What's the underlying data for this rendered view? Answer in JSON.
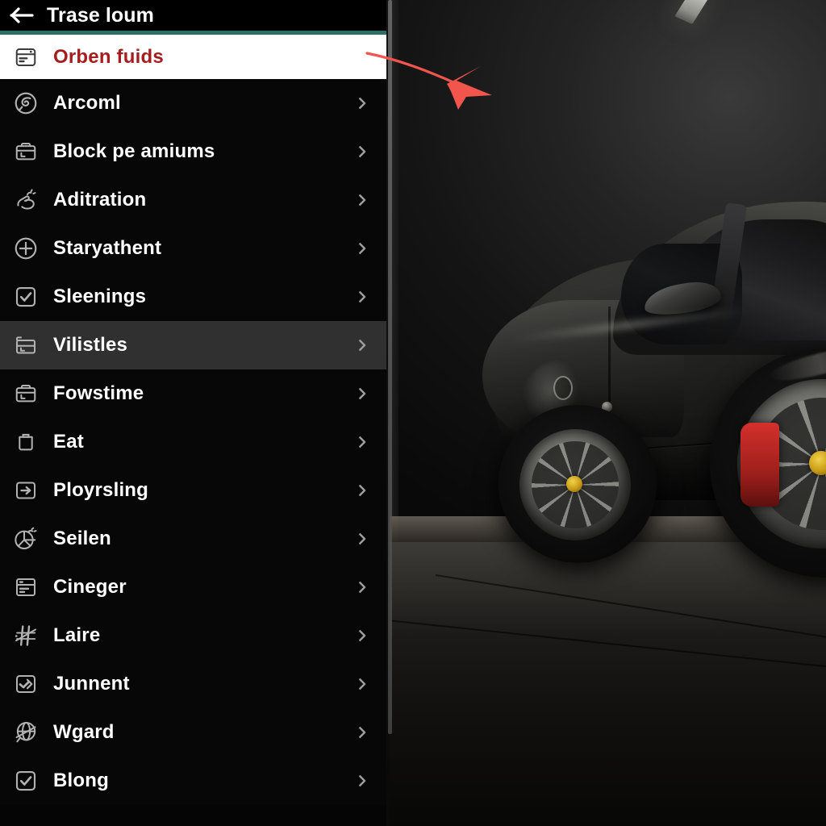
{
  "header": {
    "title": "Trase loum",
    "back_icon": "back-arrow-icon"
  },
  "colors": {
    "panel_background": "#070707",
    "selected_row_background": "#ffffff",
    "selected_row_text": "#a61d1d",
    "selected_row_accent": "#2e6e63",
    "hovered_row_background": "#303030",
    "row_text": "#ffffff",
    "icon": "#b2b2b2",
    "chevron": "#9c9c9c",
    "annotation_arrow": "#f2554c"
  },
  "annotation": {
    "type": "arrow",
    "name": "red-callout-arrow",
    "points_to": "Orben fuids",
    "color": "#f2554c"
  },
  "scrollbar": {
    "visible": true,
    "orientation": "vertical"
  },
  "menu": {
    "items": [
      {
        "label": "Orben fuids",
        "icon": "card-icon",
        "chevron": "",
        "state": "selected"
      },
      {
        "label": "Arcoml",
        "icon": "disc-icon",
        "chevron": "›",
        "state": "normal"
      },
      {
        "label": "Block pe amiums",
        "icon": "toolbox-icon",
        "chevron": "›",
        "state": "normal"
      },
      {
        "label": "Aditration",
        "icon": "hand-tap-icon",
        "chevron": "›",
        "state": "normal"
      },
      {
        "label": "Staryathent",
        "icon": "plus-circle-icon",
        "chevron": "›",
        "state": "normal"
      },
      {
        "label": "Sleenings",
        "icon": "checkbox-icon",
        "chevron": "›",
        "state": "normal"
      },
      {
        "label": "Vilistles",
        "icon": "drawer-icon",
        "chevron": "›",
        "state": "hovered"
      },
      {
        "label": "Fowstime",
        "icon": "toolbox-icon",
        "chevron": "›",
        "state": "normal"
      },
      {
        "label": "Eat",
        "icon": "bin-icon",
        "chevron": "›",
        "state": "normal"
      },
      {
        "label": "Ployrsling",
        "icon": "arrow-in-box-icon",
        "chevron": "›",
        "state": "normal"
      },
      {
        "label": "Seilen",
        "icon": "pie-chart-icon",
        "chevron": "›",
        "state": "normal"
      },
      {
        "label": "Cineger",
        "icon": "list-box-icon",
        "chevron": "›",
        "state": "normal"
      },
      {
        "label": "Laire",
        "icon": "slash-lines-icon",
        "chevron": "›",
        "state": "normal"
      },
      {
        "label": "Junnent",
        "icon": "check-box-alt-icon",
        "chevron": "›",
        "state": "normal"
      },
      {
        "label": "Wgard",
        "icon": "globe-slash-icon",
        "chevron": "›",
        "state": "normal"
      },
      {
        "label": "Blong",
        "icon": "checkbox-icon",
        "chevron": "›",
        "state": "normal"
      }
    ]
  },
  "background": {
    "description": "dark sports car parked in a dim garage",
    "name": "car-photo"
  }
}
